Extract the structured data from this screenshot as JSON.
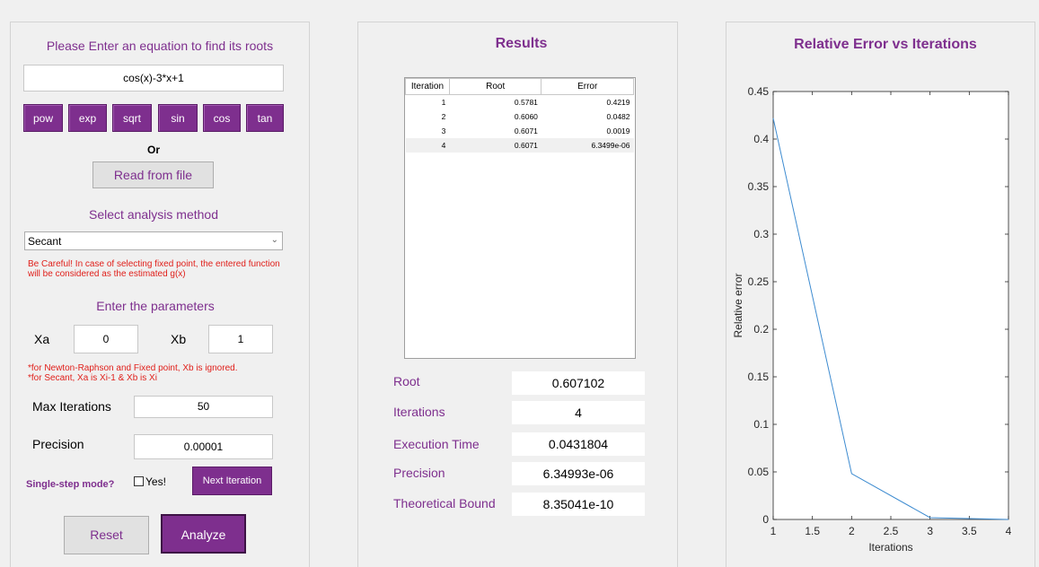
{
  "input_panel": {
    "title": "Please Enter an equation to find its roots",
    "equation_value": "cos(x)-3*x+1",
    "function_buttons": [
      "pow",
      "exp",
      "sqrt",
      "sin",
      "cos",
      "tan"
    ],
    "or_label": "Or",
    "read_file_label": "Read from file",
    "method_title": "Select analysis method",
    "method_selected": "Secant",
    "method_warning_1": "Be Careful! In case of selecting fixed point, the entered function",
    "method_warning_2": "will be considered as the estimated g(x)",
    "params_title": "Enter the parameters",
    "xa_label": "Xa",
    "xa_value": "0",
    "xb_label": "Xb",
    "xb_value": "1",
    "params_note_1": "*for Newton-Raphson and Fixed point, Xb is ignored.",
    "params_note_2": "*for Secant, Xa is Xi-1 & Xb is Xi",
    "max_iter_label": "Max Iterations",
    "max_iter_value": "50",
    "precision_label": "Precision",
    "precision_value": "0.00001",
    "single_step_label": "Single-step mode?",
    "yes_label": "Yes!",
    "next_iter_label": "Next Iteration",
    "reset_label": "Reset",
    "analyze_label": "Analyze"
  },
  "results_panel": {
    "title": "Results",
    "table_headers": [
      "Iteration",
      "Root",
      "Error"
    ],
    "table_rows": [
      [
        "1",
        "0.5781",
        "0.4219"
      ],
      [
        "2",
        "0.6060",
        "0.0482"
      ],
      [
        "3",
        "0.6071",
        "0.0019"
      ],
      [
        "4",
        "0.6071",
        "6.3499e-06"
      ]
    ],
    "root_label": "Root",
    "root_value": "0.607102",
    "iterations_label": "Iterations",
    "iterations_value": "4",
    "exec_label": "Execution Time",
    "exec_value": "0.0431804",
    "precision_label": "Precision",
    "precision_value": "6.34993e-06",
    "bound_label": "Theoretical Bound",
    "bound_value": "8.35041e-10"
  },
  "chart_data": {
    "type": "line",
    "title": "Relative Error vs Iterations",
    "xlabel": "Iterations",
    "ylabel": "Relative error",
    "x": [
      1,
      2,
      3,
      4
    ],
    "series": [
      {
        "values": [
          0.4219,
          0.0482,
          0.0019,
          6.3499e-06
        ]
      }
    ],
    "xlim": [
      1,
      4
    ],
    "ylim": [
      0,
      0.45
    ],
    "xticks": [
      "1",
      "1.5",
      "2",
      "2.5",
      "3",
      "3.5",
      "4"
    ],
    "yticks": [
      "0",
      "0.05",
      "0.1",
      "0.15",
      "0.2",
      "0.25",
      "0.3",
      "0.35",
      "0.4",
      "0.45"
    ],
    "line_color": "#3d8bd0",
    "grid": false
  },
  "colors": {
    "accent": "#7e2f8e",
    "warning": "#e0201b"
  }
}
